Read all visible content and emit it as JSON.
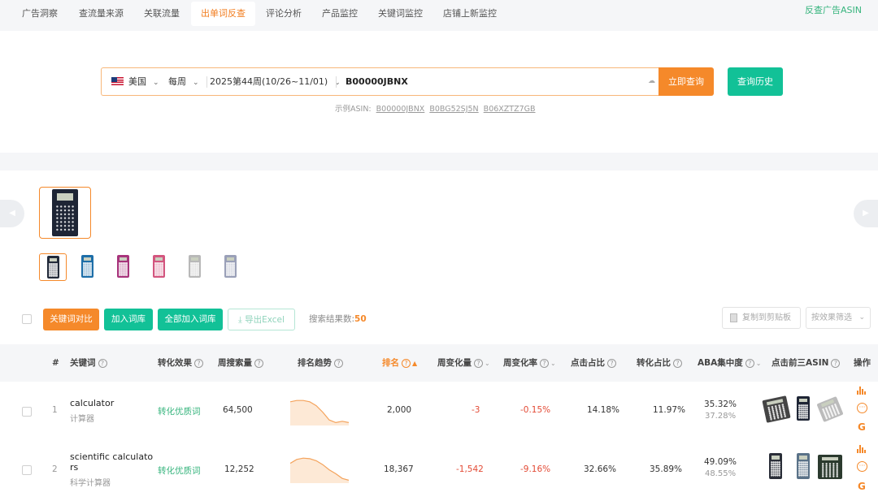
{
  "nav": {
    "items": [
      "广告洞察",
      "查流量来源",
      "关联流量",
      "出单词反查",
      "评论分析",
      "产品监控",
      "关键词监控",
      "店铺上新监控"
    ],
    "active_index": 3,
    "right_link": "反查广告ASIN"
  },
  "search": {
    "country": "美国",
    "period": "每周",
    "week": "2025第44周(10/26~11/01)",
    "asin_value": "B00000JBNX",
    "query_button": "立即查询",
    "history_button": "查询历史",
    "examples_label": "示例ASIN:",
    "examples": [
      "B00000JBNX",
      "B0BG52SJ5N",
      "B06XZTZ7GB"
    ]
  },
  "product": {
    "thumb_colors": [
      "#222a3a",
      "#1d6ea8",
      "#a8347c",
      "#d3567f",
      "#b8b8b8",
      "#9aa0b8"
    ],
    "selected_thumb": 0
  },
  "toolbar": {
    "compare_button": "关键词对比",
    "add_button": "加入词库",
    "add_all_button": "全部加入词库",
    "export_button": "导出Excel",
    "result_label": "搜索结果数:",
    "result_count": "50",
    "copy_button": "复制到剪贴板",
    "filter_placeholder": "按效果筛选"
  },
  "table": {
    "columns": {
      "index": "#",
      "keyword": "关键词",
      "conversion": "转化效果",
      "weekly_search": "周搜索量",
      "rank_trend": "排名趋势",
      "rank": "排名",
      "weekly_change": "周变化量",
      "weekly_change_rate": "周变化率",
      "click_share": "点击占比",
      "conversion_share": "转化占比",
      "aba": "ABA集中度",
      "top3": "点击前三ASIN",
      "actions": "操作"
    },
    "rows": [
      {
        "index": "1",
        "keyword": "calculator",
        "keyword_cn": "计算器",
        "conversion": "转化优质词",
        "weekly_search": "64,500",
        "trend": [
          0.85,
          0.9,
          0.9,
          0.85,
          0.7,
          0.45,
          0.15,
          0.05,
          0.1,
          0.05
        ],
        "rank": "2,000",
        "weekly_change": "-3",
        "weekly_change_rate": "-0.15%",
        "click_share": "14.18%",
        "conversion_share": "11.97%",
        "aba_main": "35.32%",
        "aba_sub": "37.28%"
      },
      {
        "index": "2",
        "keyword_line1": "scientific calculato",
        "keyword_line2": "rs",
        "keyword_cn": "科学计算器",
        "conversion": "转化优质词",
        "weekly_search": "12,252",
        "trend": [
          0.7,
          0.85,
          0.9,
          0.88,
          0.8,
          0.65,
          0.45,
          0.3,
          0.12,
          0.05
        ],
        "rank": "18,367",
        "weekly_change": "-1,542",
        "weekly_change_rate": "-9.16%",
        "click_share": "32.66%",
        "conversion_share": "35.89%",
        "aba_main": "49.09%",
        "aba_sub": "48.55%"
      }
    ]
  }
}
